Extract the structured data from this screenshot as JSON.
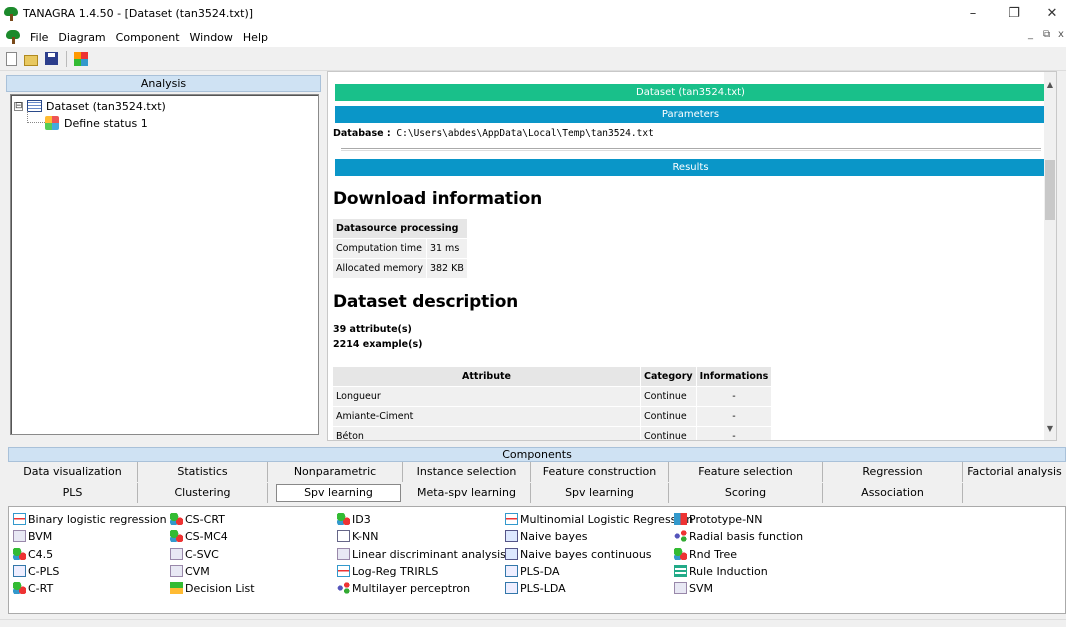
{
  "window": {
    "title": "TANAGRA 1.4.50 - [Dataset (tan3524.txt)]",
    "minimize": "–",
    "restore": "❐",
    "close": "✕"
  },
  "menu": {
    "items": [
      "File",
      "Diagram",
      "Component",
      "Window",
      "Help"
    ],
    "mdi_min": "_",
    "mdi_restore": "⧉",
    "mdi_close": "x"
  },
  "analysis": {
    "header": "Analysis",
    "tree": [
      {
        "label": "Dataset (tan3524.txt)",
        "expander": "⊟"
      },
      {
        "label": "Define status 1"
      }
    ]
  },
  "report": {
    "dataset_bar": "Dataset (tan3524.txt)",
    "parameters_bar": "Parameters",
    "database_label": "Database :",
    "database_path": "C:\\Users\\abdes\\AppData\\Local\\Temp\\tan3524.txt",
    "results_bar": "Results",
    "download_title": "Download information",
    "download_table": {
      "header": "Datasource processing",
      "rows": [
        [
          "Computation time",
          "31 ms"
        ],
        [
          "Allocated memory",
          "382 KB"
        ]
      ]
    },
    "dataset_title": "Dataset description",
    "attributes_count": "39 attribute(s)",
    "examples_count": "2214 example(s)",
    "attr_table": {
      "headers": [
        "Attribute",
        "Category",
        "Informations"
      ],
      "rows": [
        [
          "Longueur",
          "Continue",
          "-"
        ],
        [
          "Amiante-Ciment",
          "Continue",
          "-"
        ],
        [
          "Béton",
          "Continue",
          "-"
        ]
      ]
    }
  },
  "components": {
    "header": "Components",
    "tabs_row1": [
      "Data visualization",
      "Statistics",
      "Nonparametric statistics",
      "Instance selection",
      "Feature construction",
      "Feature selection",
      "Regression",
      "Factorial analysis"
    ],
    "tabs_row2": [
      "PLS",
      "Clustering",
      "Spv learning",
      "Meta-spv learning",
      "Spv learning assessment",
      "Scoring",
      "Association"
    ],
    "active_tab": "Spv learning",
    "items": [
      [
        "Binary logistic regression",
        "BVM",
        "C4.5",
        "C-PLS",
        "C-RT"
      ],
      [
        "CS-CRT",
        "CS-MC4",
        "C-SVC",
        "CVM",
        "Decision List"
      ],
      [
        "ID3",
        "K-NN",
        "Linear discriminant analysis",
        "Log-Reg TRIRLS",
        "Multilayer perceptron"
      ],
      [
        "Multinomial Logistic Regression",
        "Naive bayes",
        "Naive bayes continuous",
        "PLS-DA",
        "PLS-LDA"
      ],
      [
        "Prototype-NN",
        "Radial basis function",
        "Rnd Tree",
        "Rule Induction",
        "SVM"
      ]
    ],
    "icons": [
      [
        "logistic-icon",
        "svm-icon",
        "tree-icon",
        "pls-icon",
        "tree-icon"
      ],
      [
        "tree-icon",
        "tree-icon",
        "svm-icon",
        "svm-icon",
        "decision-list-icon"
      ],
      [
        "tree-icon",
        "knn-icon",
        "svm-icon",
        "logistic-icon",
        "neural-net-icon"
      ],
      [
        "logistic-icon",
        "naive-bayes-icon",
        "naive-bayes-icon",
        "pls-icon",
        "pls-icon"
      ],
      [
        "prototype-icon",
        "neural-net-icon",
        "tree-icon",
        "rule-icon",
        "svm-icon"
      ]
    ]
  }
}
